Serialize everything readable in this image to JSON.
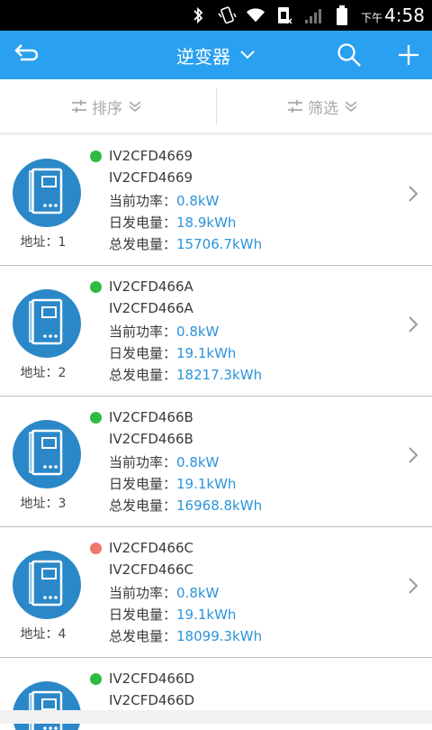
{
  "status_bar": {
    "ampm": "下午",
    "time": "4:58",
    "icons": [
      "bluetooth-icon",
      "vibrate-icon",
      "wifi-icon",
      "sim-icon",
      "signal-icon",
      "battery-icon"
    ]
  },
  "app_bar": {
    "title": "逆变器",
    "icons": [
      "back-icon",
      "chevron-down-icon",
      "search-icon",
      "add-icon"
    ]
  },
  "filters": {
    "sort_label": "排序",
    "filter_label": "筛选"
  },
  "labels": {
    "power": "当前功率：",
    "daily": "日发电量：",
    "total": "总发电量："
  },
  "colors": {
    "app_bar": "#2aa0f0",
    "value": "#2b93d9",
    "online": "#2dbb43",
    "fault": "#f0776c",
    "avatar": "#2b88c8"
  },
  "devices": [
    {
      "status": "online",
      "name": "IV2CFD4669",
      "model": "IV2CFD4669",
      "power": "0.8kW",
      "daily": "18.9kWh",
      "total": "15706.7kWh",
      "address": "地址：1"
    },
    {
      "status": "online",
      "name": "IV2CFD466A",
      "model": "IV2CFD466A",
      "power": "0.8kW",
      "daily": "19.1kWh",
      "total": "18217.3kWh",
      "address": "地址：2"
    },
    {
      "status": "online",
      "name": "IV2CFD466B",
      "model": "IV2CFD466B",
      "power": "0.8kW",
      "daily": "19.1kWh",
      "total": "16968.8kWh",
      "address": "地址：3"
    },
    {
      "status": "fault",
      "name": "IV2CFD466C",
      "model": "IV2CFD466C",
      "power": "0.8kW",
      "daily": "19.1kWh",
      "total": "18099.3kWh",
      "address": "地址：4"
    },
    {
      "status": "online",
      "name": "IV2CFD466D",
      "model": "IV2CFD466D"
    }
  ]
}
